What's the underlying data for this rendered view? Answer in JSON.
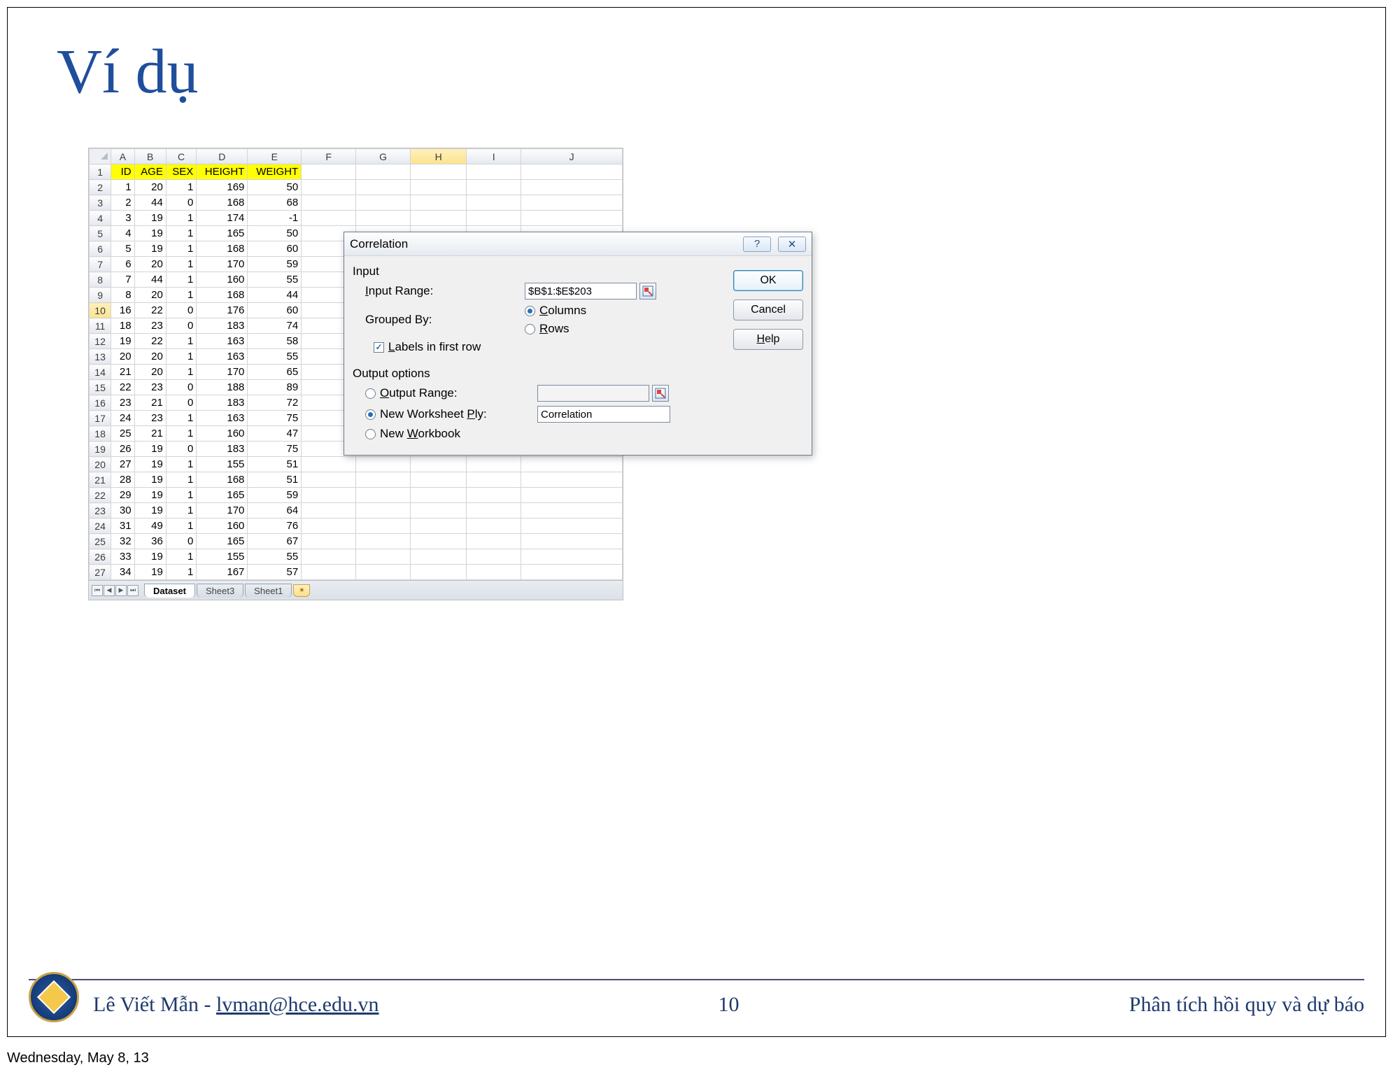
{
  "slide": {
    "title": "Ví dụ",
    "page_number": "10",
    "author_name": "Lê Viết Mẫn",
    "author_sep": " - ",
    "author_email": "lvman@hce.edu.vn",
    "topic": "Phân tích hồi quy và dự báo",
    "date": "Wednesday, May 8, 13"
  },
  "spreadsheet": {
    "columns": [
      "A",
      "B",
      "C",
      "D",
      "E",
      "F",
      "G",
      "H",
      "I",
      "J"
    ],
    "headers": [
      "ID",
      "AGE",
      "SEX",
      "HEIGHT",
      "WEIGHT"
    ],
    "selected_col": "H",
    "selected_row": "10",
    "rows": [
      {
        "n": "1",
        "hdr": true
      },
      {
        "n": "2",
        "d": [
          "1",
          "20",
          "1",
          "169",
          "50"
        ]
      },
      {
        "n": "3",
        "d": [
          "2",
          "44",
          "0",
          "168",
          "68"
        ]
      },
      {
        "n": "4",
        "d": [
          "3",
          "19",
          "1",
          "174",
          "-1"
        ]
      },
      {
        "n": "5",
        "d": [
          "4",
          "19",
          "1",
          "165",
          "50"
        ]
      },
      {
        "n": "6",
        "d": [
          "5",
          "19",
          "1",
          "168",
          "60"
        ]
      },
      {
        "n": "7",
        "d": [
          "6",
          "20",
          "1",
          "170",
          "59"
        ]
      },
      {
        "n": "8",
        "d": [
          "7",
          "44",
          "1",
          "160",
          "55"
        ]
      },
      {
        "n": "9",
        "d": [
          "8",
          "20",
          "1",
          "168",
          "44"
        ]
      },
      {
        "n": "10",
        "d": [
          "16",
          "22",
          "0",
          "176",
          "60"
        ]
      },
      {
        "n": "11",
        "d": [
          "18",
          "23",
          "0",
          "183",
          "74"
        ]
      },
      {
        "n": "12",
        "d": [
          "19",
          "22",
          "1",
          "163",
          "58"
        ]
      },
      {
        "n": "13",
        "d": [
          "20",
          "20",
          "1",
          "163",
          "55"
        ]
      },
      {
        "n": "14",
        "d": [
          "21",
          "20",
          "1",
          "170",
          "65"
        ]
      },
      {
        "n": "15",
        "d": [
          "22",
          "23",
          "0",
          "188",
          "89"
        ]
      },
      {
        "n": "16",
        "d": [
          "23",
          "21",
          "0",
          "183",
          "72"
        ]
      },
      {
        "n": "17",
        "d": [
          "24",
          "23",
          "1",
          "163",
          "75"
        ]
      },
      {
        "n": "18",
        "d": [
          "25",
          "21",
          "1",
          "160",
          "47"
        ]
      },
      {
        "n": "19",
        "d": [
          "26",
          "19",
          "0",
          "183",
          "75"
        ]
      },
      {
        "n": "20",
        "d": [
          "27",
          "19",
          "1",
          "155",
          "51"
        ]
      },
      {
        "n": "21",
        "d": [
          "28",
          "19",
          "1",
          "168",
          "51"
        ]
      },
      {
        "n": "22",
        "d": [
          "29",
          "19",
          "1",
          "165",
          "59"
        ]
      },
      {
        "n": "23",
        "d": [
          "30",
          "19",
          "1",
          "170",
          "64"
        ]
      },
      {
        "n": "24",
        "d": [
          "31",
          "49",
          "1",
          "160",
          "76"
        ]
      },
      {
        "n": "25",
        "d": [
          "32",
          "36",
          "0",
          "165",
          "67"
        ]
      },
      {
        "n": "26",
        "d": [
          "33",
          "19",
          "1",
          "155",
          "55"
        ]
      },
      {
        "n": "27",
        "d": [
          "34",
          "19",
          "1",
          "167",
          "57"
        ]
      }
    ],
    "tabs": {
      "active": "Dataset",
      "others": [
        "Sheet3",
        "Sheet1"
      ]
    }
  },
  "dialog": {
    "title": "Correlation",
    "buttons": {
      "ok": "OK",
      "cancel": "Cancel",
      "help_pre": "",
      "help_u": "H",
      "help_post": "elp"
    },
    "input_section": "Input",
    "input_range": {
      "pre": "",
      "u": "I",
      "post": "nput Range:",
      "value": "$B$1:$E$203"
    },
    "grouped_by": {
      "label": "Grouped By:",
      "col": {
        "pre": "",
        "u": "C",
        "post": "olumns",
        "checked": true
      },
      "row": {
        "pre": "",
        "u": "R",
        "post": "ows",
        "checked": false
      }
    },
    "labels_first": {
      "pre": "",
      "u": "L",
      "post": "abels in first row",
      "checked": true
    },
    "output_section": "Output options",
    "output_range": {
      "pre": "",
      "u": "O",
      "post": "utput Range:",
      "checked": false,
      "value": ""
    },
    "new_ply": {
      "pre": "New Worksheet ",
      "u": "P",
      "post": "ly:",
      "checked": true,
      "value": "Correlation"
    },
    "new_wb": {
      "pre": "New ",
      "u": "W",
      "post": "orkbook",
      "checked": false
    }
  }
}
